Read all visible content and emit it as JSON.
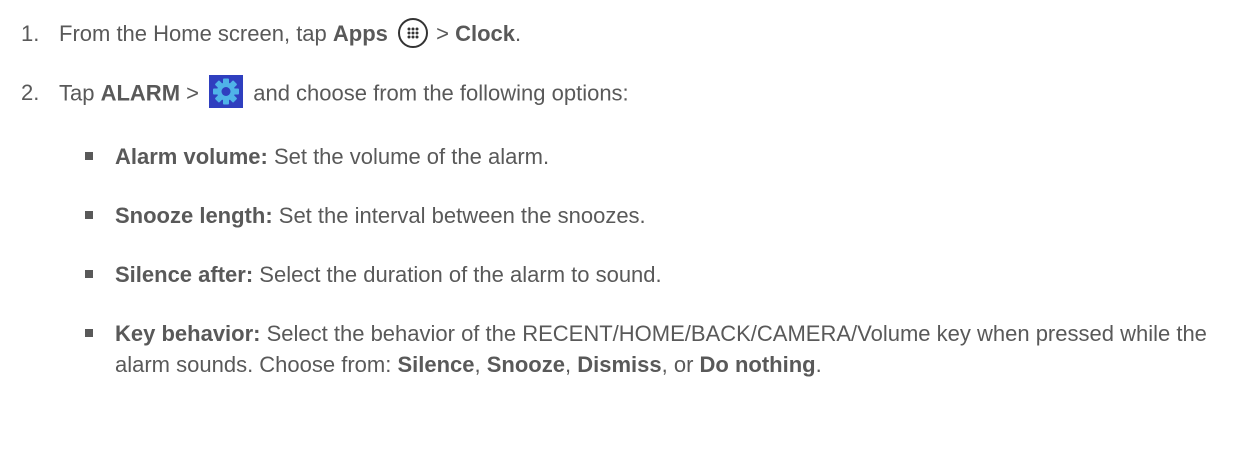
{
  "step1": {
    "number": "1.",
    "text_a": "From the Home screen, tap ",
    "apps": "Apps",
    "gt": " > ",
    "clock": "Clock",
    "period": "."
  },
  "step2": {
    "number": "2.",
    "text_a": "Tap ",
    "alarm": "ALARM",
    "gt": " > ",
    "text_b": " and choose from the following options:"
  },
  "bullets": [
    {
      "term": "Alarm volume:",
      "desc": " Set the volume of the alarm."
    },
    {
      "term": "Snooze length:",
      "desc": " Set the interval between the snoozes."
    },
    {
      "term": "Silence after:",
      "desc": " Select the duration of the alarm to sound."
    }
  ],
  "key_behavior": {
    "term": "Key behavior:",
    "desc_a": " Select the behavior of the RECENT/HOME/BACK/CAMERA/Volume key when pressed while the alarm sounds. Choose from: ",
    "opt1": "Silence",
    "sep1": ", ",
    "opt2": "Snooze",
    "sep2": ", ",
    "opt3": "Dismiss",
    "sep3": ", or ",
    "opt4": "Do nothing",
    "end": "."
  },
  "icons": {
    "apps": "apps-grid-icon",
    "settings": "gear-icon",
    "settings_color": "#1e74c8",
    "settings_bg": "#3a3fbf"
  }
}
